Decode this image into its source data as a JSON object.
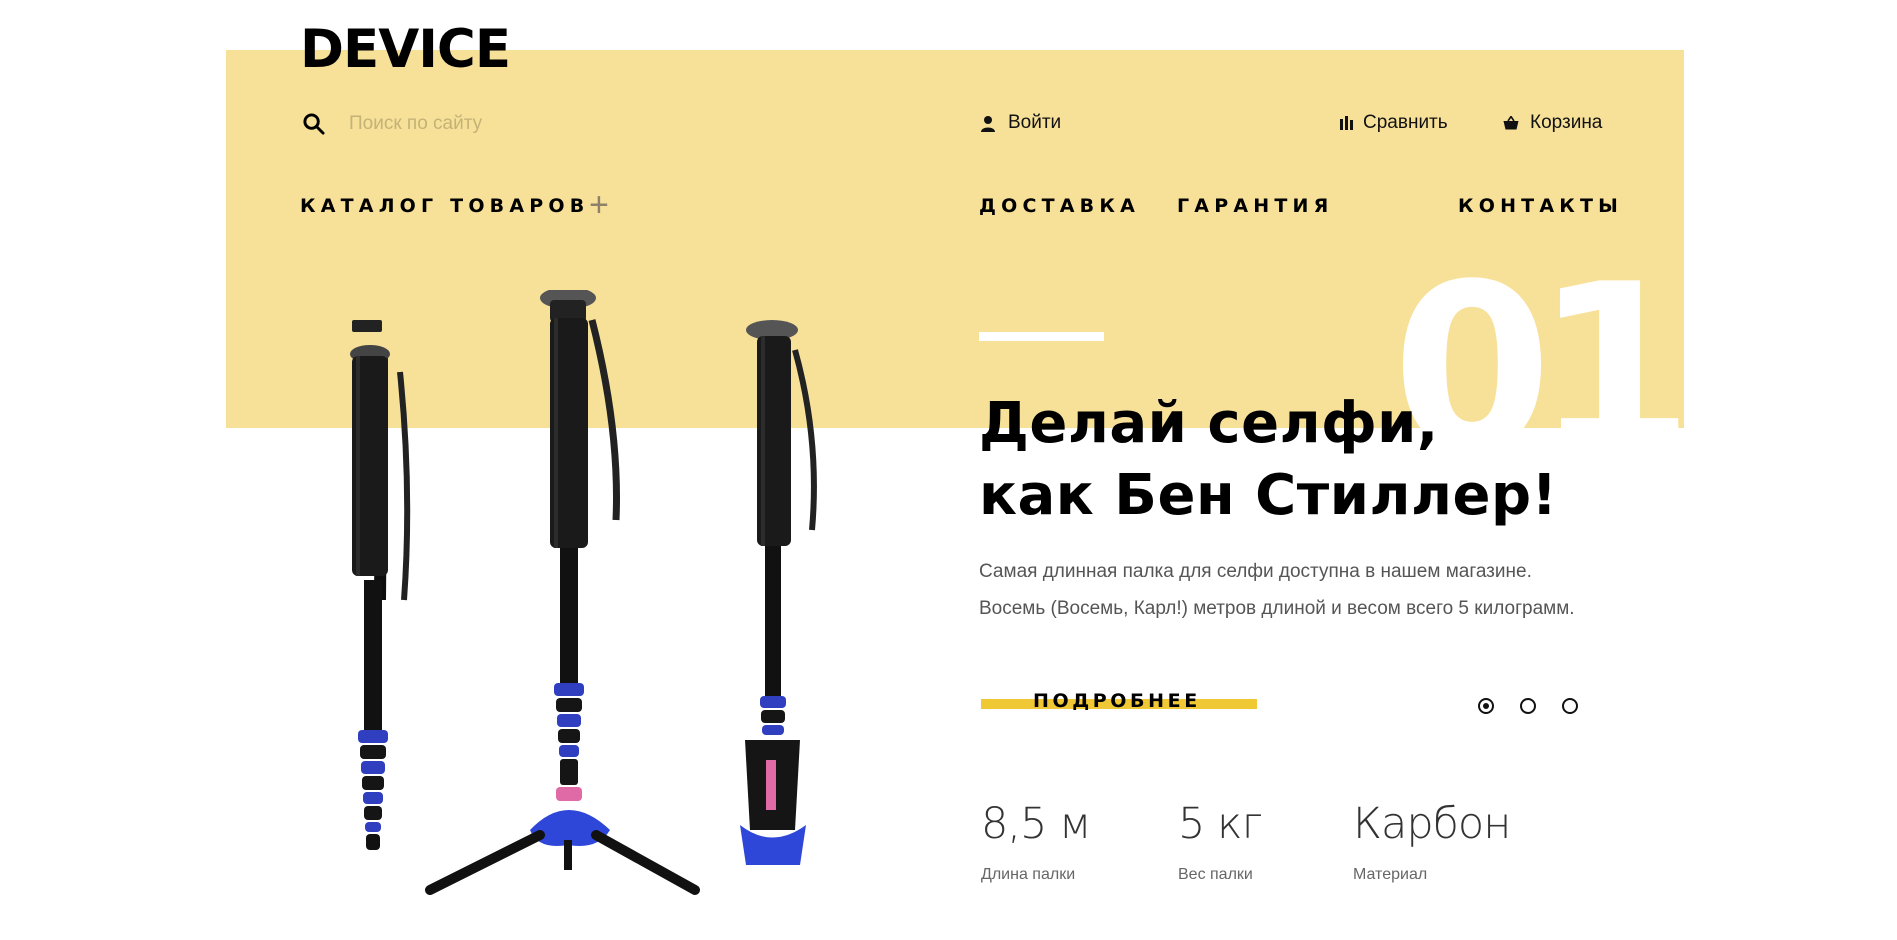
{
  "header": {
    "logo": "DEVICE",
    "search": {
      "placeholder": "Поиск по сайту"
    },
    "login_label": "Войти",
    "compare_label": "Сравнить",
    "cart_label": "Корзина"
  },
  "nav": {
    "catalog": "КАТАЛОГ ТОВАРОВ",
    "delivery": "ДОСТАВКА",
    "warranty": "ГАРАНТИЯ",
    "contacts": "КОНТАКТЫ"
  },
  "slide": {
    "number": "01",
    "title_line1": "Делай селфи,",
    "title_line2": "как Бен Стиллер!",
    "description_line1": "Самая длинная палка для селфи доступна в нашем магазине.",
    "description_line2": "Восемь (Восемь, Карл!) метров длиной и весом всего 5 килограмм.",
    "more_button": "ПОДРОБНЕЕ",
    "active_dot": 0,
    "dots_count": 3
  },
  "stats": [
    {
      "value": "8,5 м",
      "caption": "Длина палки"
    },
    {
      "value": "5 кг",
      "caption": "Вес палки"
    },
    {
      "value": "Карбон",
      "caption": "Материал"
    }
  ],
  "colors": {
    "band": "#f7e199",
    "accent": "#f0c735",
    "text": "#000000"
  },
  "icons": {
    "search": "search-icon",
    "user": "user-icon",
    "compare": "bar-chart-icon",
    "cart": "basket-icon",
    "plus": "plus-icon"
  }
}
